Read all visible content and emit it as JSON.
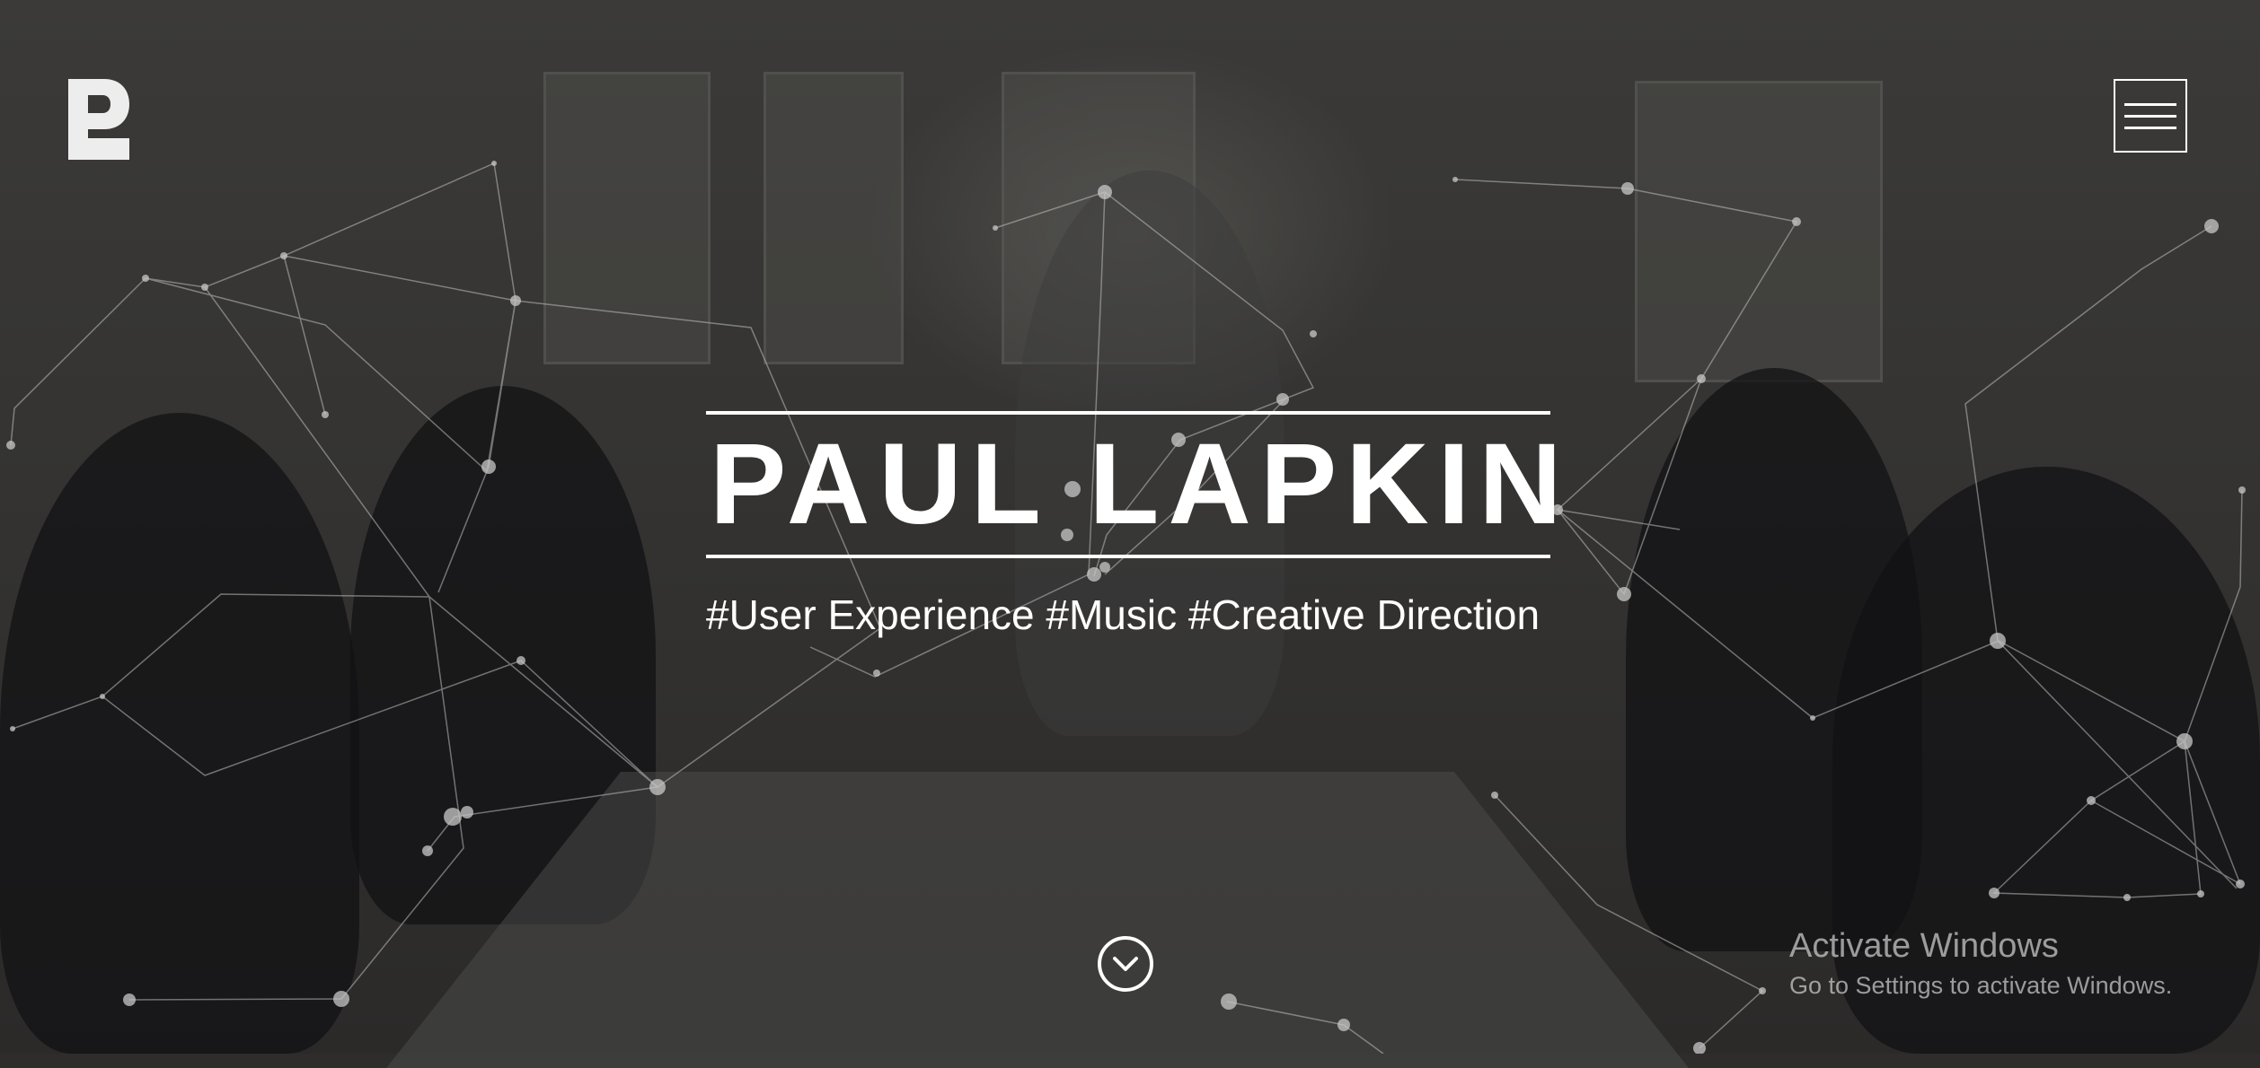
{
  "brand": {
    "logo_icon": "p-logo-icon",
    "color": "#ffffff"
  },
  "nav": {
    "menu_icon": "hamburger-menu-icon"
  },
  "hero": {
    "title": "PAUL LAPKIN",
    "tags": "#User Experience #Music #Creative Direction",
    "scroll_icon": "chevron-down-circle-icon"
  },
  "overlay": {
    "activate_title": "Activate Windows",
    "activate_subtitle": "Go to Settings to activate Windows."
  },
  "colors": {
    "text": "#ffffff",
    "network_line": "#bdbdbd",
    "network_node": "#c8c8c8",
    "overlay_dim": "#2e2d2b"
  }
}
